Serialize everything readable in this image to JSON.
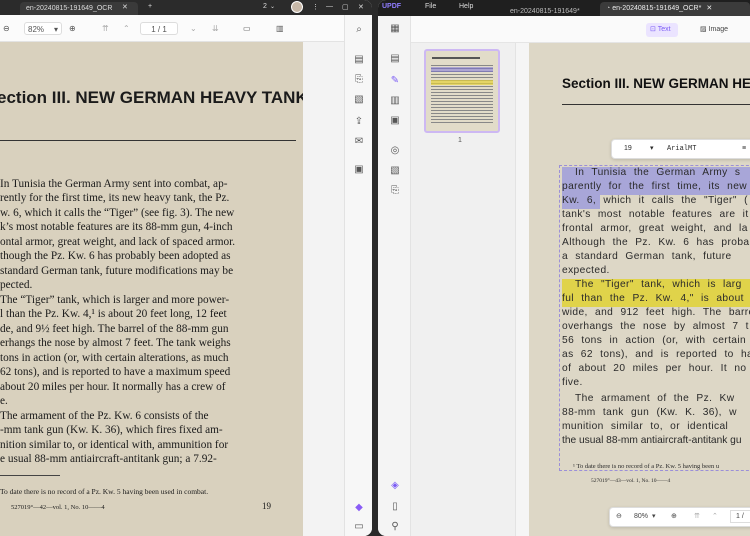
{
  "left_window": {
    "tab_title": "en-20240815-191649_OCR",
    "tab_counter": "2",
    "zoom": "82%",
    "page_indicator": "1 / 1",
    "page": {
      "heading": "ection III. NEW GERMAN HEAVY TANK",
      "lines": [
        "In Tunisia the German Army sent into combat, ap-",
        "rently for the first time, its new heavy tank, the Pz.",
        "w. 6, which it calls the “Tiger” (see fig. 3).  The new",
        "k’s most notable features are its 88-mm gun, 4-inch",
        "ontal armor, great weight, and lack of spaced armor.",
        "though the Pz. Kw. 6 has probably been adopted as",
        "standard German tank, future modifications may be",
        "pected.",
        "The “Tiger” tank, which is larger and more power-",
        "l than the Pz. Kw. 4,¹ is about 20 feet long, 12 feet",
        "de, and 9½ feet high.  The barrel of the 88-mm gun",
        "erhangs the nose by almost 7 feet.  The tank weighs",
        "tons in action (or, with certain alterations, as much",
        "62 tons), and is reported to have a maximum speed",
        "about 20 miles per hour.  It normally has a crew of",
        "e.",
        "The armament of the Pz. Kw. 6 consists of the",
        "-mm tank gun (Kw. K. 36), which fires fixed am-",
        "nition similar to, or identical with, ammunition for",
        "e usual 88-mm antiaircraft-antitank gun; a 7.92-"
      ],
      "footnote": "To date there is no record of a Pz. Kw. 5 having been used in combat.",
      "printer_line": "527019°—42—vol. 1, No. 10——4",
      "page_number": "19"
    }
  },
  "right_window": {
    "menu": {
      "file": "File",
      "help": "Help"
    },
    "tab1_title": "en-20240815-191649*",
    "tab2_title": "en-20240815-191649_OCR*",
    "tools": {
      "text": "Text",
      "image": "Image"
    },
    "thumb_page_number": "1",
    "format_bar": {
      "font_size": "19",
      "font_name": "ArialMT"
    },
    "zoom": "80%",
    "page_indicator": "1 /",
    "page": {
      "heading": "Section III. NEW GERMAN HE",
      "lines": [
        "In  Tunisia  the  German  Army  s",
        "parently  for  the  first  time,  its  new",
        "Kw.  6,  which  it  calls  the  \"Tiger\" (",
        "tank's  most  notable  features  are  it",
        "frontal  armor,  great  weight,  and  la",
        "Although  the  Pz.  Kw.  6  has  proba",
        "a  standard  German  tank,  future",
        "expected.",
        "The  \"Tiger\"  tank,  which  is  larg",
        "ful  than  the  Pz.  Kw.  4,\"  is  about",
        "wide,  and  912  feet  high.  The  barre",
        "overhangs  the  nose  by  almost  7  t",
        "56  tons  in  action  (or,  with  certain",
        "as  62  tons),  and  is  reported  to  ha",
        "of  about  20  miles  per  hour.  It  no",
        "five.",
        "The  armament  of  the  Pz.  Kw",
        "88-mm  tank  gun  (Kw.  K.  36),  w",
        "munition  similar  to,  or  identical",
        "the usual 88-mm antiaircraft-antitank gu"
      ],
      "footnote": "¹ To date there is no record of a Pz. Kw. 5 having been u",
      "printer_line": "527019°—43—vol. 1, No. 10——4"
    }
  },
  "colors": {
    "highlight_purple": "#a8a6d8",
    "highlight_yellow": "#e0d34a",
    "accent": "#7b5cf5"
  }
}
